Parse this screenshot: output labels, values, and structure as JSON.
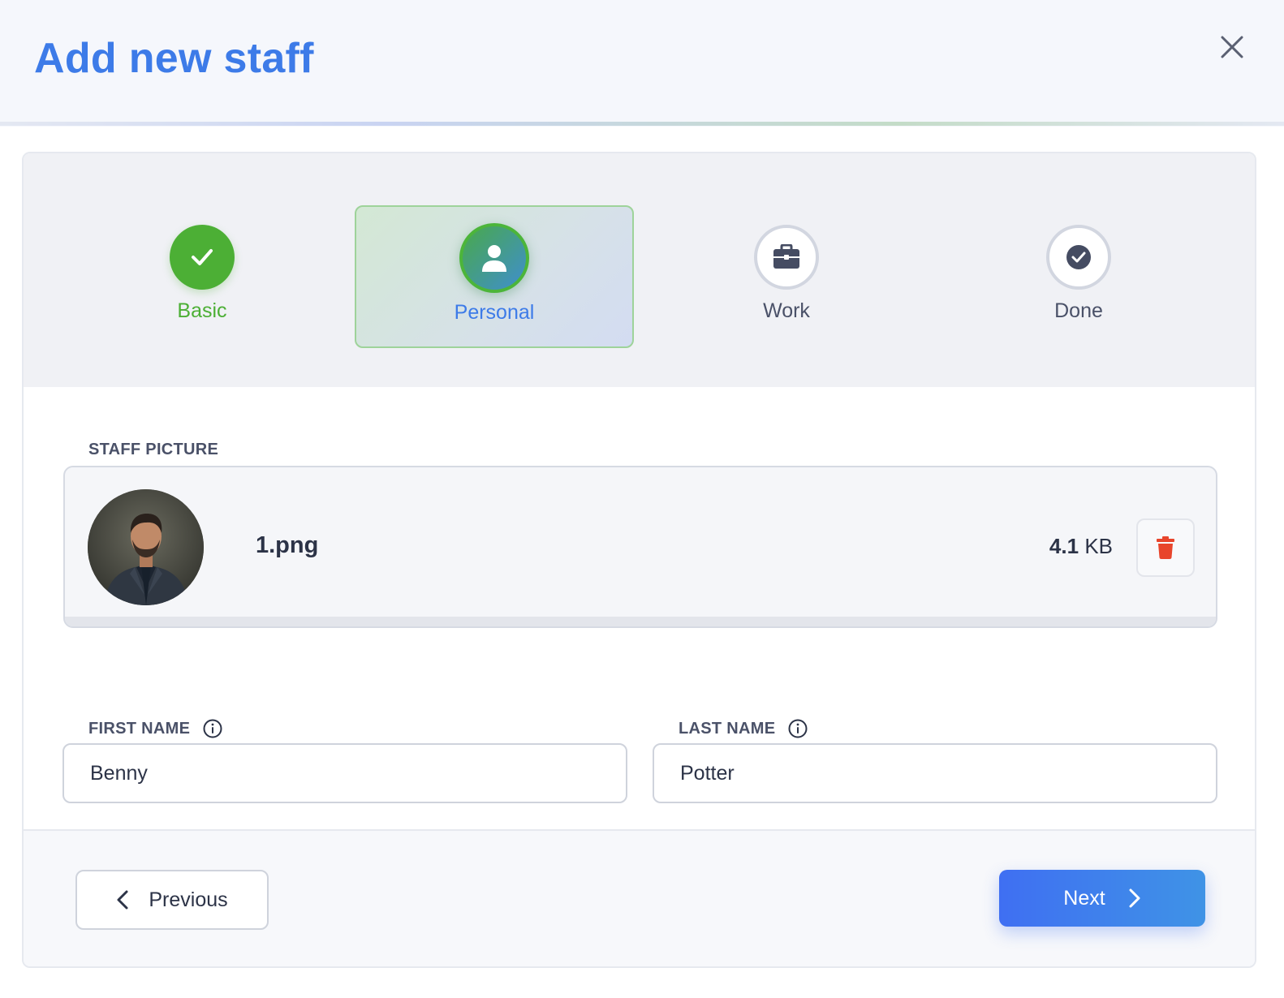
{
  "header": {
    "title": "Add new staff",
    "close_icon": "close-icon"
  },
  "stepper": {
    "steps": [
      {
        "label": "Basic",
        "icon": "check-icon",
        "state": "completed"
      },
      {
        "label": "Personal",
        "icon": "user-icon",
        "state": "active"
      },
      {
        "label": "Work",
        "icon": "briefcase-icon",
        "state": "pending"
      },
      {
        "label": "Done",
        "icon": "check-circle-icon",
        "state": "pending"
      }
    ]
  },
  "picture": {
    "label": "STAFF PICTURE",
    "file_name": "1.png",
    "file_size_value": "4.1",
    "file_size_unit": "KB",
    "delete_icon": "trash-icon"
  },
  "fields": {
    "first_name": {
      "label": "FIRST NAME",
      "value": "Benny"
    },
    "last_name": {
      "label": "LAST NAME",
      "value": "Potter"
    }
  },
  "footer": {
    "previous_label": "Previous",
    "next_label": "Next"
  },
  "colors": {
    "accent_blue": "#3d7be8",
    "success_green": "#4caf35",
    "danger_red": "#e8452c"
  }
}
